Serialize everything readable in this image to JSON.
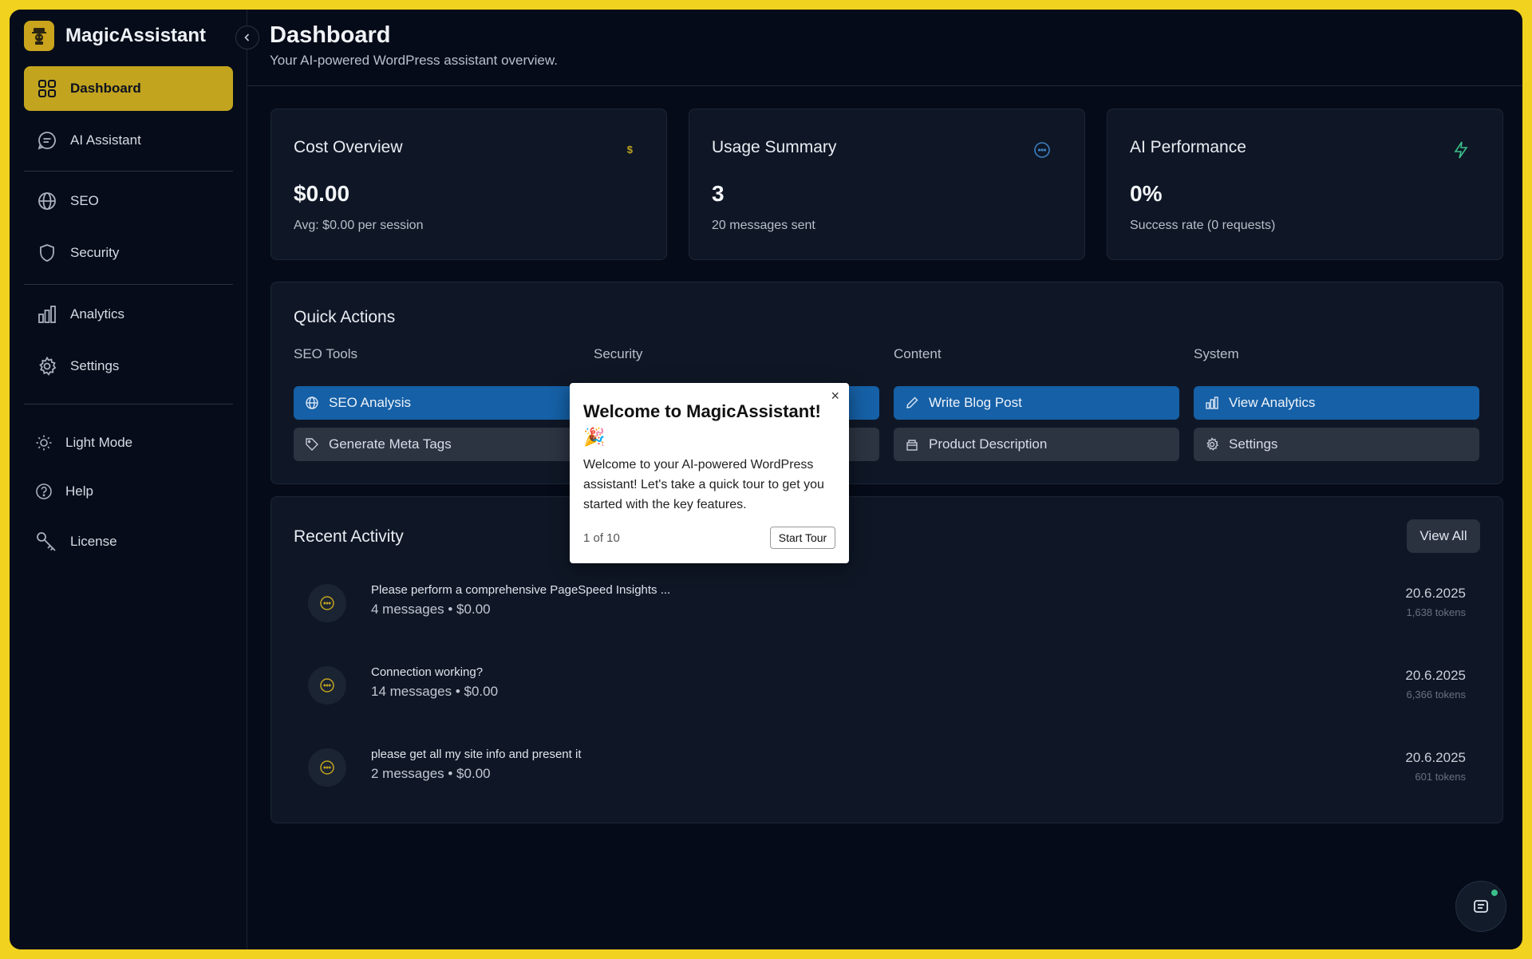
{
  "brand": {
    "name": "MagicAssistant"
  },
  "sidebar": {
    "items": [
      {
        "label": "Dashboard",
        "icon": "dashboard-icon",
        "active": true
      },
      {
        "label": "AI Assistant",
        "icon": "chat-icon"
      },
      {
        "label": "SEO",
        "icon": "globe-icon"
      },
      {
        "label": "Security",
        "icon": "shield-icon"
      },
      {
        "label": "Analytics",
        "icon": "bar-chart-icon"
      },
      {
        "label": "Settings",
        "icon": "gear-icon"
      }
    ],
    "footer": [
      {
        "label": "Light Mode",
        "icon": "sun-icon"
      },
      {
        "label": "Help",
        "icon": "help-icon"
      },
      {
        "label": "License",
        "icon": "key-icon"
      }
    ]
  },
  "header": {
    "title": "Dashboard",
    "subtitle": "Your AI-powered WordPress assistant overview."
  },
  "stats": [
    {
      "title": "Cost Overview",
      "value": "$0.00",
      "sub": "Avg: $0.00 per session",
      "icon": "dollar-icon"
    },
    {
      "title": "Usage Summary",
      "value": "3",
      "sub": "20 messages sent",
      "icon": "chat-bubble-icon"
    },
    {
      "title": "AI Performance",
      "value": "0%",
      "sub": "Success rate (0 requests)",
      "icon": "lightning-icon"
    }
  ],
  "quick_actions": {
    "title": "Quick Actions",
    "columns": [
      {
        "label": "SEO Tools",
        "primary": "SEO Analysis",
        "secondary": "Generate Meta Tags"
      },
      {
        "label": "Security",
        "primary": "",
        "secondary": ""
      },
      {
        "label": "Content",
        "primary": "Write Blog Post",
        "secondary": "Product Description"
      },
      {
        "label": "System",
        "primary": "View Analytics",
        "secondary": "Settings"
      }
    ]
  },
  "recent_activity": {
    "title": "Recent Activity",
    "view_all": "View All",
    "items": [
      {
        "title": "Please perform a comprehensive PageSpeed Insights ...",
        "meta": "4 messages • $0.00",
        "date": "20.6.2025",
        "tokens": "1,638 tokens"
      },
      {
        "title": "Connection working?",
        "meta": "14 messages • $0.00",
        "date": "20.6.2025",
        "tokens": "6,366 tokens"
      },
      {
        "title": "please get all my site info and present it",
        "meta": "2 messages • $0.00",
        "date": "20.6.2025",
        "tokens": "601 tokens"
      }
    ]
  },
  "tour": {
    "title": "Welcome to MagicAssistant! 🎉",
    "body": "Welcome to your AI-powered WordPress assistant! Let's take a quick tour to get you started with the key features.",
    "counter": "1 of 10",
    "start": "Start Tour",
    "close": "×"
  },
  "colors": {
    "accent": "#c2a41e",
    "primary_button": "#1560a6",
    "frame": "#f0d21f",
    "background": "#050b18"
  }
}
